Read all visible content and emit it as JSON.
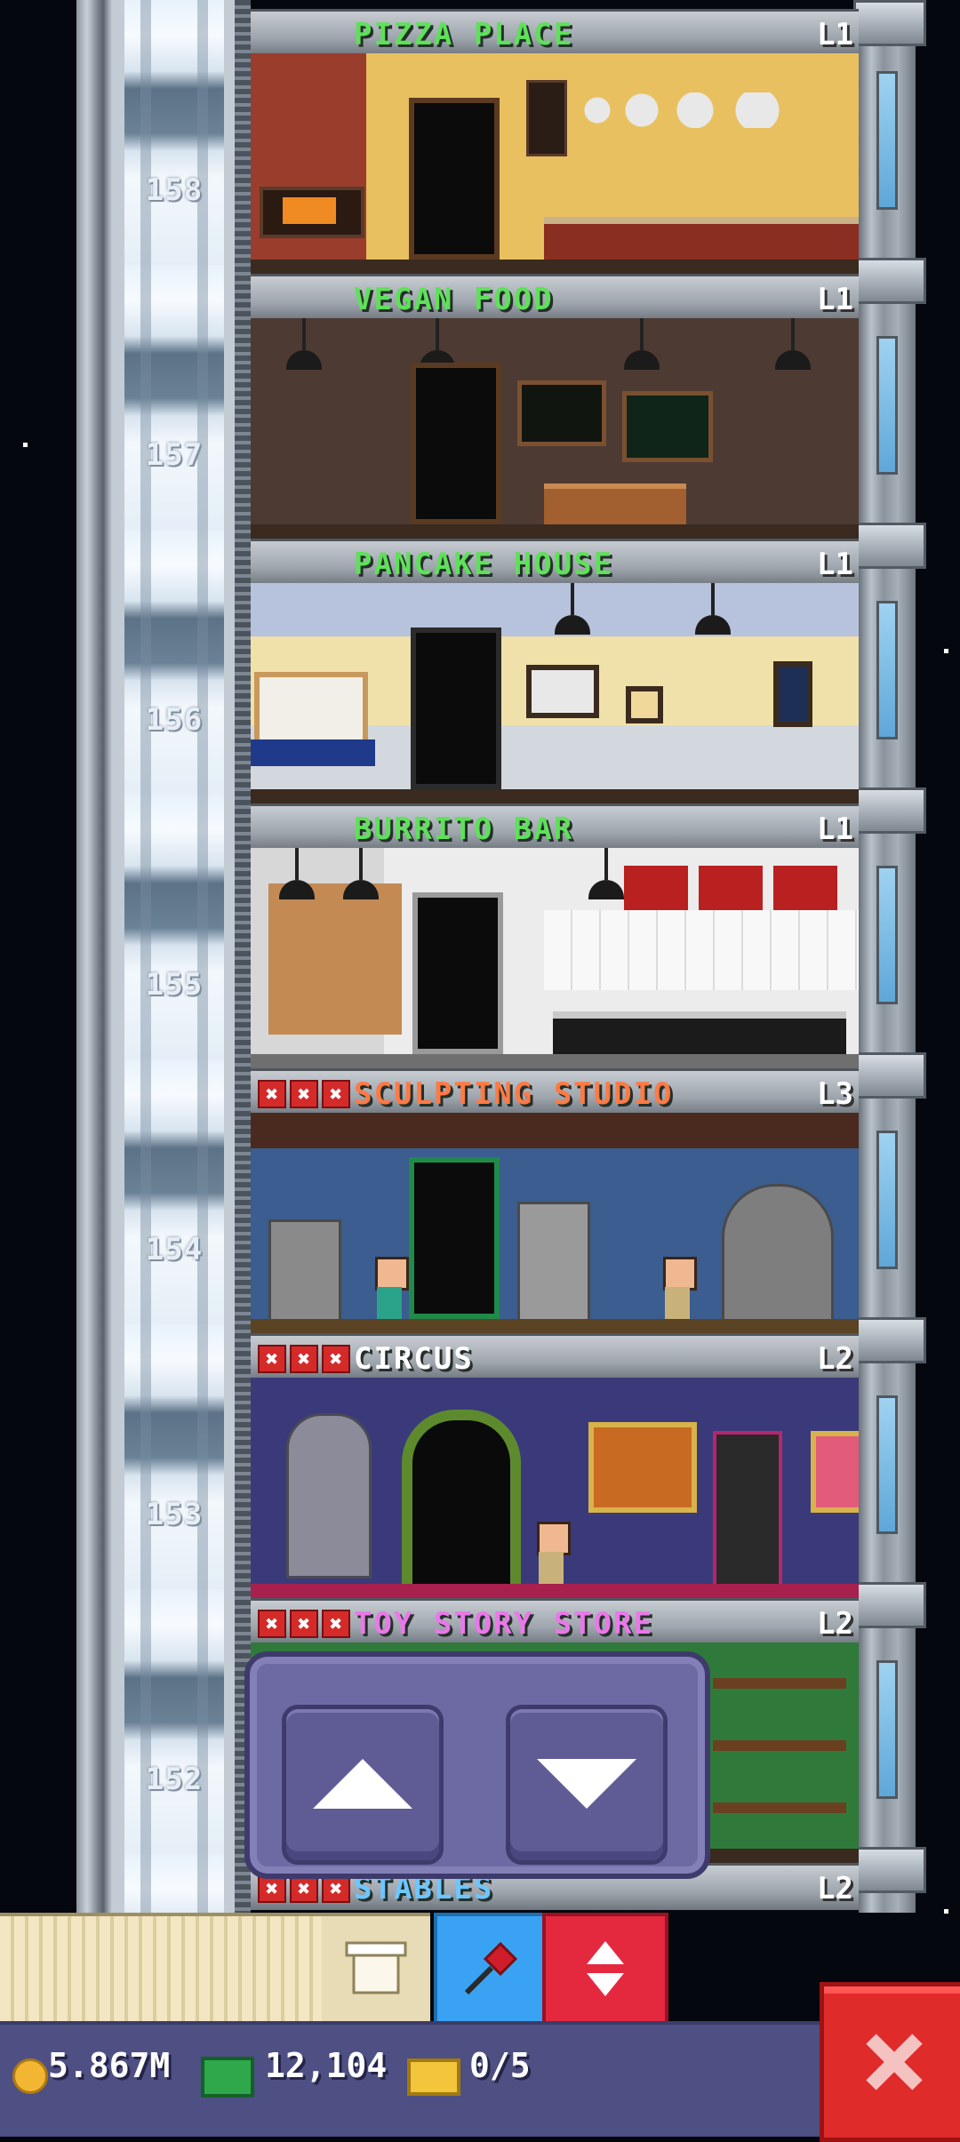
{
  "floors": [
    {
      "num": "158",
      "name": "PIZZA PLACE",
      "level": "L1",
      "color": "#5fe05a",
      "stars_missing": 0
    },
    {
      "num": "157",
      "name": "VEGAN FOOD",
      "level": "L1",
      "color": "#5fe05a",
      "stars_missing": 0
    },
    {
      "num": "156",
      "name": "PANCAKE HOUSE",
      "level": "L1",
      "color": "#5fe05a",
      "stars_missing": 0
    },
    {
      "num": "155",
      "name": "BURRITO BAR",
      "level": "L1",
      "color": "#5fe05a",
      "stars_missing": 0
    },
    {
      "num": "154",
      "name": "SCULPTING STUDIO",
      "level": "L3",
      "color": "#ff7a45",
      "stars_missing": 3
    },
    {
      "num": "153",
      "name": "CIRCUS",
      "level": "L2",
      "color": "#ffffff",
      "stars_missing": 3
    },
    {
      "num": "152",
      "name": "TOY STORY STORE",
      "level": "L2",
      "color": "#e978e8",
      "stars_missing": 3
    },
    {
      "name": "STABLES",
      "level": "L2",
      "color": "#6ec6ff",
      "stars_missing": 3
    }
  ],
  "xmark_glyph": "✖",
  "status": {
    "coins": "5.867M",
    "bux": "12,104",
    "tickets": "0/5"
  },
  "colors": {
    "coin": "#f2b632",
    "bux": "#2ea84a",
    "ticket": "#f2c53a"
  },
  "icons": {
    "up": "arrow-up",
    "down": "arrow-down",
    "box": "box",
    "pin": "pushpin",
    "elevator": "up-down",
    "close": "close"
  }
}
